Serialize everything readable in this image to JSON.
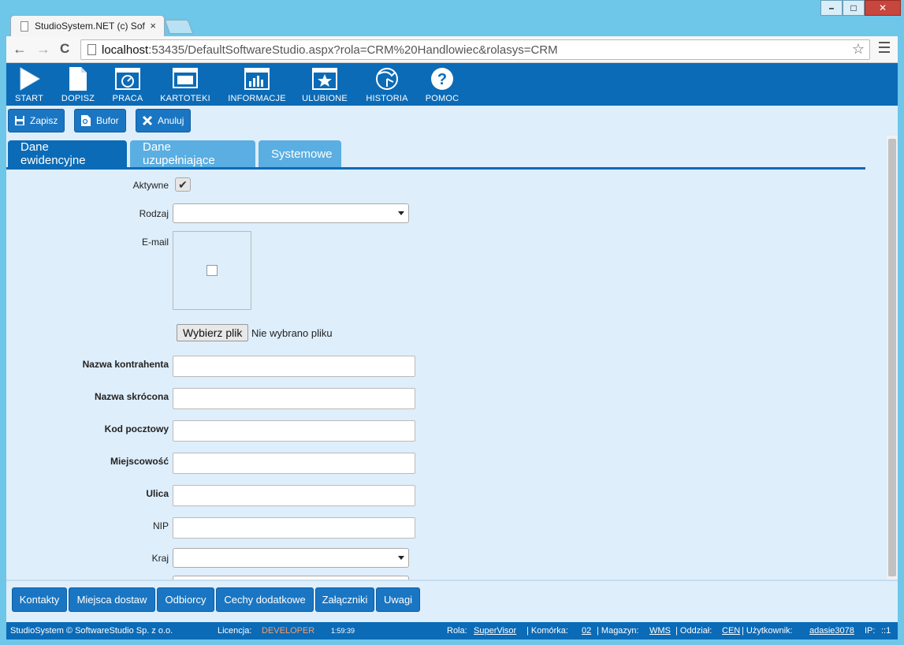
{
  "browser": {
    "tab_title": "StudioSystem.NET (c) Soft",
    "tab_close": "×",
    "url_host": "localhost",
    "url_rest": ":53435/DefaultSoftwareStudio.aspx?rola=CRM%20Handlowiec&rolasys=CRM",
    "back": "←",
    "forward": "→",
    "reload": "C",
    "star": "☆",
    "win_min": "–",
    "win_max": "□",
    "win_close": "✕"
  },
  "toolbar": {
    "items": [
      {
        "label": "START",
        "icon": "play-icon"
      },
      {
        "label": "DOPISZ",
        "icon": "document-icon"
      },
      {
        "label": "PRACA",
        "icon": "gauge-icon"
      },
      {
        "label": "KARTOTEKI",
        "icon": "monitor-icon"
      },
      {
        "label": "INFORMACJE",
        "icon": "chart-icon"
      },
      {
        "label": "ULUBIONE",
        "icon": "star-icon"
      },
      {
        "label": "HISTORIA",
        "icon": "history-icon"
      },
      {
        "label": "POMOC",
        "icon": "help-icon"
      }
    ]
  },
  "actions": {
    "save": "Zapisz",
    "buffer": "Bufor",
    "cancel": "Anuluj"
  },
  "tabs": [
    {
      "label": "Dane ewidencyjne",
      "active": true
    },
    {
      "label": "Dane uzupełniające",
      "active": false
    },
    {
      "label": "Systemowe",
      "active": false
    }
  ],
  "form": {
    "aktywne_label": "Aktywne",
    "aktywne_checked": "✔",
    "rodzaj_label": "Rodzaj",
    "email_label": "E-mail",
    "file_button": "Wybierz plik",
    "file_status": "Nie wybrano pliku",
    "nazwa_label": "Nazwa kontrahenta",
    "skrocona_label": "Nazwa skrócona",
    "kod_label": "Kod pocztowy",
    "miejscowosc_label": "Miejscowość",
    "ulica_label": "Ulica",
    "nip_label": "NIP",
    "kraj_label": "Kraj"
  },
  "bottom_buttons": [
    "Kontakty",
    "Miejsca dostaw",
    "Odbiorcy",
    "Cechy dodatkowe",
    "Załączniki",
    "Uwagi"
  ],
  "status": {
    "copyright": "StudioSystem © SoftwareStudio Sp. z o.o.",
    "licencja_label": "Licencja:",
    "licencja_value": "DEVELOPER",
    "timer": "1:59:39",
    "rola_label": "Rola:",
    "rola_value": "SuperVisor",
    "komorka_label": "| Komórka:",
    "komorka_value": "02",
    "magazyn_label": "| Magazyn:",
    "magazyn_value": "WMS",
    "oddzial_label": "| Oddział:",
    "oddzial_value": "CEN",
    "uzytkownik_label": "| Użytkownik:",
    "uzytkownik_value": "adasie3078",
    "ip_label": "IP:",
    "ip_value": "::1"
  }
}
